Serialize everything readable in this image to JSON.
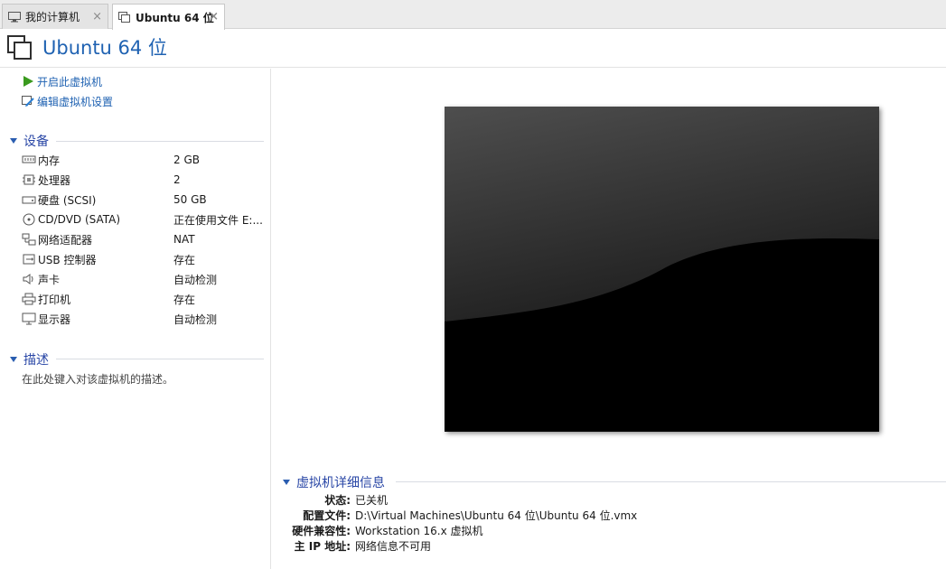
{
  "tabs": [
    {
      "label": "我的计算机",
      "icon": "monitor-icon",
      "close": "×"
    },
    {
      "label": "Ubuntu 64 位",
      "icon": "vm-icon",
      "close": "×"
    }
  ],
  "header": {
    "title": "Ubuntu 64 位",
    "icon": "vm-icon",
    "title_color": "#1f62b2"
  },
  "actions": {
    "start": {
      "label": "开启此虚拟机",
      "icon": "play-icon"
    },
    "edit": {
      "label": "编辑虚拟机设置",
      "icon": "edit-settings-icon"
    }
  },
  "devices": {
    "heading": "设备",
    "items": [
      {
        "name": "内存",
        "value": "2 GB",
        "icon": "memory-icon"
      },
      {
        "name": "处理器",
        "value": "2",
        "icon": "processor-icon"
      },
      {
        "name": "硬盘 (SCSI)",
        "value": "50 GB",
        "icon": "harddisk-icon"
      },
      {
        "name": "CD/DVD (SATA)",
        "value": "正在使用文件 E:...",
        "icon": "cd-dvd-icon"
      },
      {
        "name": "网络适配器",
        "value": "NAT",
        "icon": "network-adapter-icon"
      },
      {
        "name": "USB 控制器",
        "value": "存在",
        "icon": "usb-icon"
      },
      {
        "name": "声卡",
        "value": "自动检测",
        "icon": "sound-icon"
      },
      {
        "name": "打印机",
        "value": "存在",
        "icon": "printer-icon"
      },
      {
        "name": "显示器",
        "value": "自动检测",
        "icon": "display-icon"
      }
    ]
  },
  "description": {
    "heading": "描述",
    "text": "在此处键入对该虚拟机的描述。"
  },
  "details": {
    "heading": "虚拟机详细信息",
    "rows": [
      {
        "key": "状态:",
        "value": "已关机"
      },
      {
        "key": "配置文件:",
        "value": "D:\\Virtual Machines\\Ubuntu 64 位\\Ubuntu 64 位.vmx"
      },
      {
        "key": "硬件兼容性:",
        "value": "Workstation 16.x 虚拟机"
      },
      {
        "key": "主 IP 地址:",
        "value": "网络信息不可用"
      }
    ]
  },
  "colors": {
    "accent": "#1f62b2",
    "section": "#2a47a6",
    "play": "#3a9a1e"
  }
}
